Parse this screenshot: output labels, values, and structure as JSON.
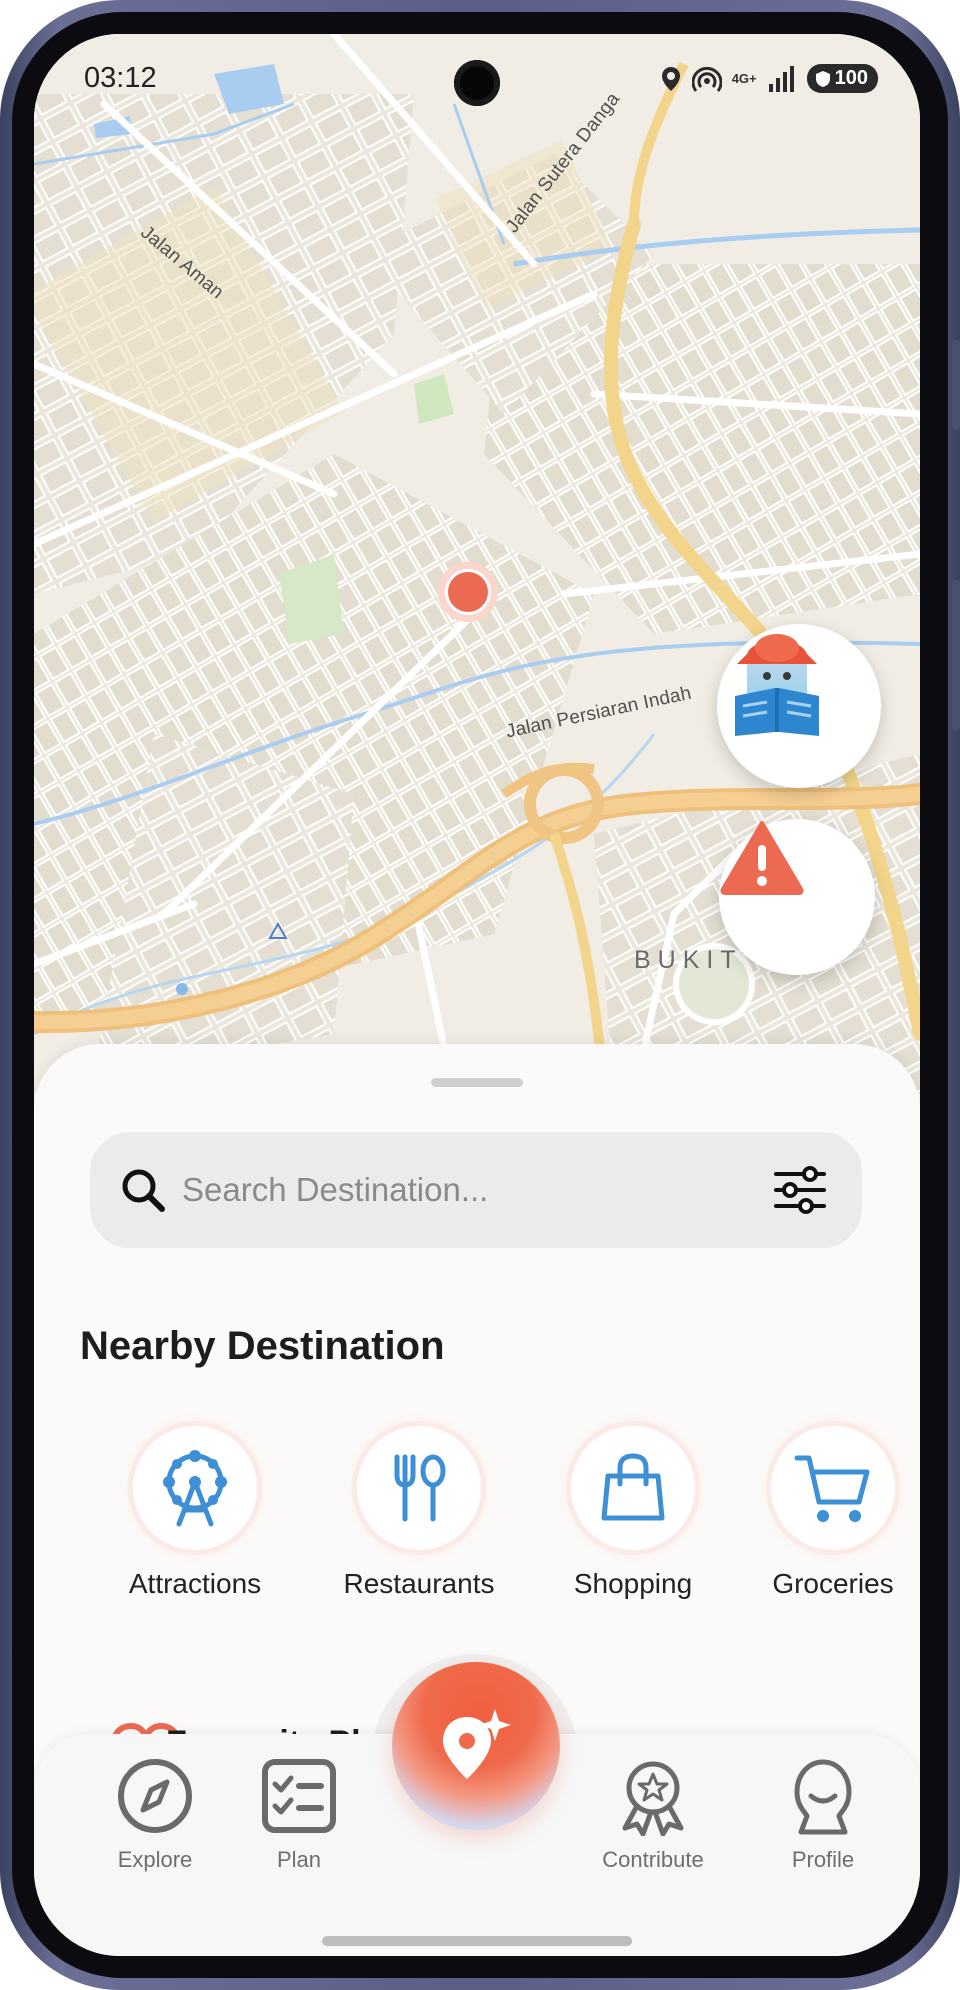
{
  "status_bar": {
    "time": "03:12",
    "network": "4G+",
    "battery": "100"
  },
  "map": {
    "labels": {
      "jalan_aman": "Jalan Aman",
      "jalan_sutera": "Jalan Sutera Danga",
      "jalan_persiaran": "Jalan Persiaran Indah",
      "bukit": "BUKIT"
    },
    "fab_guide_icon": "tourist-guide-icon",
    "fab_alert_icon": "warning-triangle-icon"
  },
  "search": {
    "placeholder": "Search Destination...",
    "value": ""
  },
  "nearby": {
    "title": "Nearby Destination",
    "categories": [
      {
        "label": "Attractions",
        "icon": "ferris-wheel-icon"
      },
      {
        "label": "Restaurants",
        "icon": "fork-spoon-icon"
      },
      {
        "label": "Shopping",
        "icon": "shopping-bag-icon"
      },
      {
        "label": "Groceries",
        "icon": "cart-icon"
      }
    ]
  },
  "favourite": {
    "title": "Favourite Pla"
  },
  "nav": {
    "items": [
      {
        "label": "Explore",
        "icon": "compass-icon"
      },
      {
        "label": "Plan",
        "icon": "checklist-icon"
      },
      {
        "label": "Contribute",
        "icon": "award-ribbon-icon"
      },
      {
        "label": "Profile",
        "icon": "profile-icon"
      }
    ],
    "center_icon": "location-sparkle-icon"
  },
  "colors": {
    "accent": "#EC6A52",
    "icon_blue": "#3D8FD6",
    "road_major": "#F2C98A",
    "map_bg": "#F1EDE4"
  }
}
